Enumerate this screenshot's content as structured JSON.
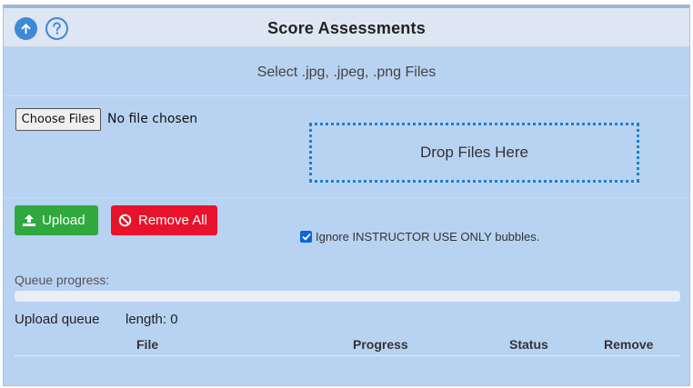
{
  "header": {
    "title": "Score Assessments",
    "icons": {
      "up": "arrow-up-circle-icon",
      "help": "question-circle-icon"
    }
  },
  "upload_section": {
    "subtitle": "Select .jpg, .jpeg, .png Files",
    "choose_files_label": "Choose Files",
    "file_status": "No file chosen",
    "dropzone_label": "Drop Files Here"
  },
  "actions": {
    "upload_label": "Upload",
    "remove_all_label": "Remove All",
    "ignore_checkbox_label": "Ignore INSTRUCTOR USE ONLY bubbles.",
    "ignore_checked": true
  },
  "queue": {
    "progress_label": "Queue progress:",
    "progress_fraction": 0,
    "title": "Upload queue",
    "length_text": "length: 0",
    "columns": [
      "File",
      "Progress",
      "Status",
      "Remove"
    ],
    "rows": []
  },
  "colors": {
    "panel_bg": "#b8d3f2",
    "header_bg": "#dde6f2",
    "accent": "#3e88d8",
    "upload_green": "#2fa93e",
    "remove_red": "#e8122a",
    "dropzone_border": "#1a80d4"
  }
}
